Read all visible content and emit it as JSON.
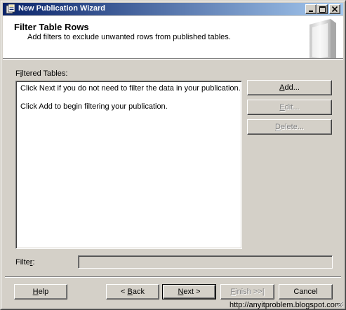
{
  "window": {
    "title": "New Publication Wizard"
  },
  "header": {
    "title": "Filter Table Rows",
    "subtitle": "Add filters to exclude unwanted rows from published tables."
  },
  "filtered_tables": {
    "label_pre": "F",
    "label_mnemonic": "i",
    "label_post": "ltered Tables:",
    "lines": [
      "Click Next if you do not need to filter the data in your publication.",
      "Click Add to begin filtering your publication."
    ]
  },
  "side_buttons": {
    "add": {
      "pre": "",
      "mnemonic": "A",
      "post": "dd..."
    },
    "edit": {
      "pre": "",
      "mnemonic": "E",
      "post": "dit..."
    },
    "delete": {
      "pre": "",
      "mnemonic": "D",
      "post": "elete..."
    }
  },
  "filter": {
    "label_pre": "Filte",
    "label_mnemonic": "r",
    "label_post": ":",
    "value": ""
  },
  "footer": {
    "help": {
      "pre": "",
      "mnemonic": "H",
      "post": "elp"
    },
    "back": {
      "pre": "< ",
      "mnemonic": "B",
      "post": "ack"
    },
    "next": {
      "pre": "",
      "mnemonic": "N",
      "post": "ext >"
    },
    "finish": {
      "pre": "",
      "mnemonic": "F",
      "post": "inish >>|"
    },
    "cancel": {
      "label": "Cancel"
    }
  },
  "watermark": "http://anyitproblem.blogspot.com"
}
